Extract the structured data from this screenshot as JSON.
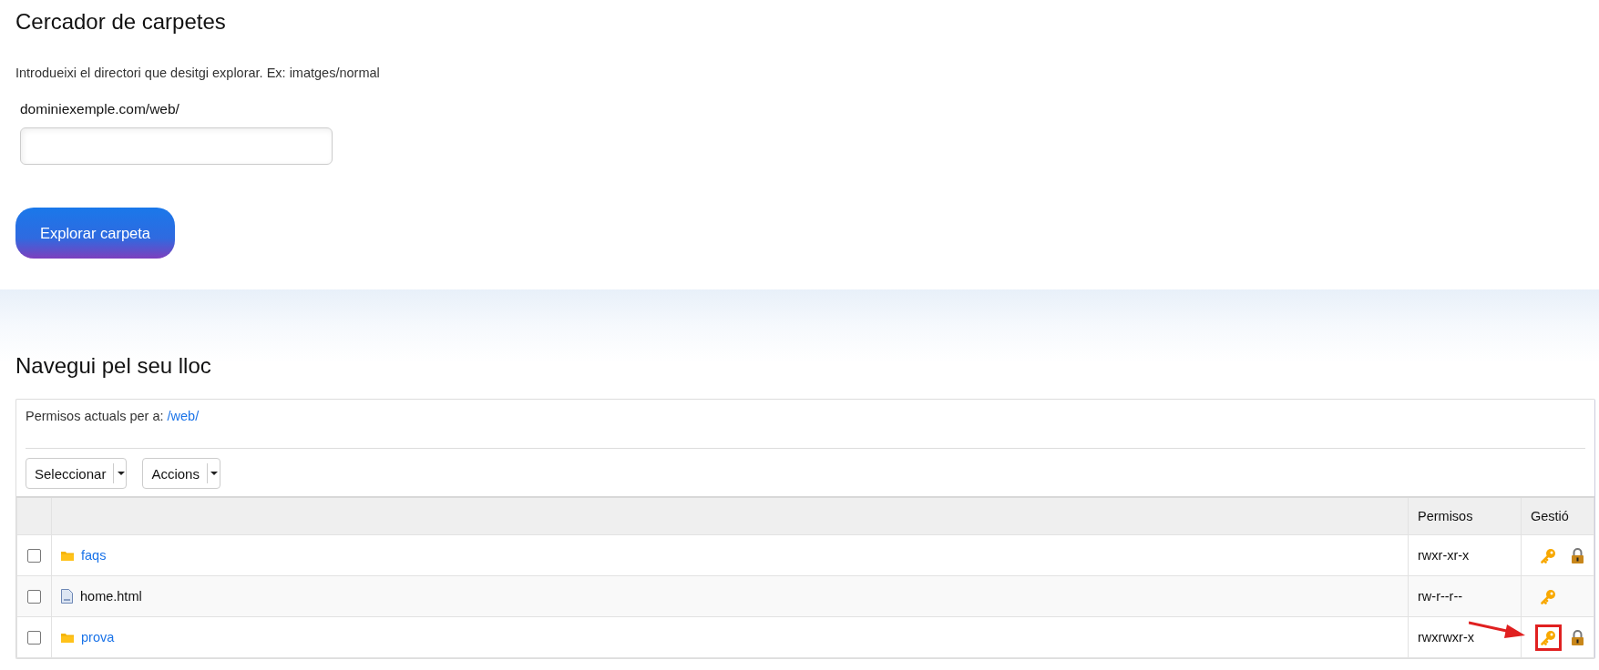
{
  "search_card": {
    "title": "Cercador de carpetes",
    "instructions": "Introdueixi el directori que desitgi explorar. Ex: imatges/normal",
    "field_label": "dominiexemple.com/web/",
    "button": "Explorar carpeta"
  },
  "browser_card": {
    "title": "Navegui pel seu lloc",
    "path_label": "Permisos actuals per a:",
    "path_link": "/web/",
    "dropdowns": [
      "Seleccionar",
      "Accions"
    ],
    "columns": [
      "Permisos",
      "Gestió"
    ],
    "rows": [
      {
        "kind": "folder",
        "name": "faqs",
        "checked": false,
        "permissions": "rwxr-xr-x",
        "actions": [
          {
            "kind": "key",
            "highlighted": false
          },
          {
            "kind": "lock",
            "highlighted": false
          }
        ]
      },
      {
        "kind": "file",
        "name": "home.html",
        "checked": false,
        "permissions": "rw-r--r--",
        "actions": [
          {
            "kind": "key",
            "highlighted": false
          }
        ]
      },
      {
        "kind": "folder",
        "name": "prova",
        "checked": false,
        "permissions": "rwxrwxr-x",
        "actions": [
          {
            "kind": "key",
            "highlighted": true
          },
          {
            "kind": "lock",
            "highlighted": false
          }
        ]
      }
    ]
  }
}
